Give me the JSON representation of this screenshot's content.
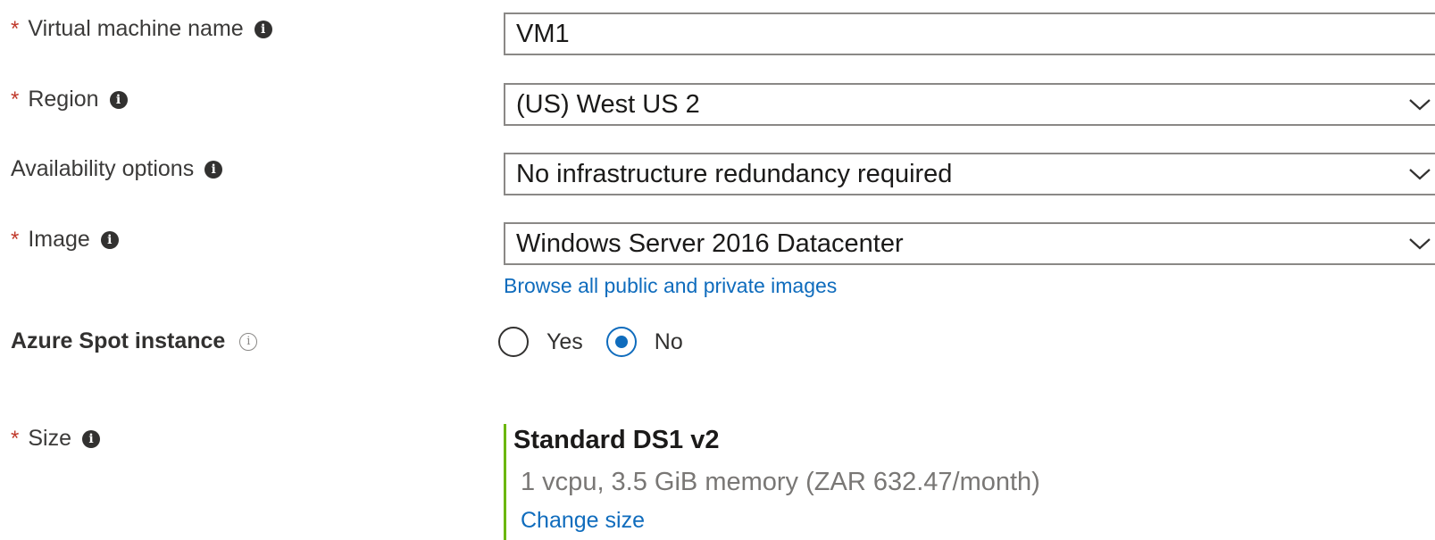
{
  "form": {
    "vm_name": {
      "label": "Virtual machine name",
      "required": true,
      "value": "VM1"
    },
    "region": {
      "label": "Region",
      "required": true,
      "value": "(US) West US 2"
    },
    "availability": {
      "label": "Availability options",
      "required": false,
      "value": "No infrastructure redundancy required"
    },
    "image": {
      "label": "Image",
      "required": true,
      "value": "Windows Server 2016 Datacenter",
      "browse_link": "Browse all public and private images"
    },
    "spot": {
      "label": "Azure Spot instance",
      "options": [
        {
          "label": "Yes",
          "checked": false
        },
        {
          "label": "No",
          "checked": true
        }
      ]
    },
    "size": {
      "label": "Size",
      "required": true,
      "name": "Standard DS1 v2",
      "detail": "1 vcpu, 3.5 GiB memory (ZAR 632.47/month)",
      "change_link": "Change size"
    }
  },
  "symbols": {
    "required_marker": "*",
    "info_glyph": "i"
  },
  "colors": {
    "required": "#c0392b",
    "link": "#0f6cbd",
    "radio_checked": "#0f6cbd",
    "size_accent": "#6bb700"
  },
  "icons": [
    "info-icon",
    "chevron-down-icon",
    "info-outline-icon"
  ]
}
